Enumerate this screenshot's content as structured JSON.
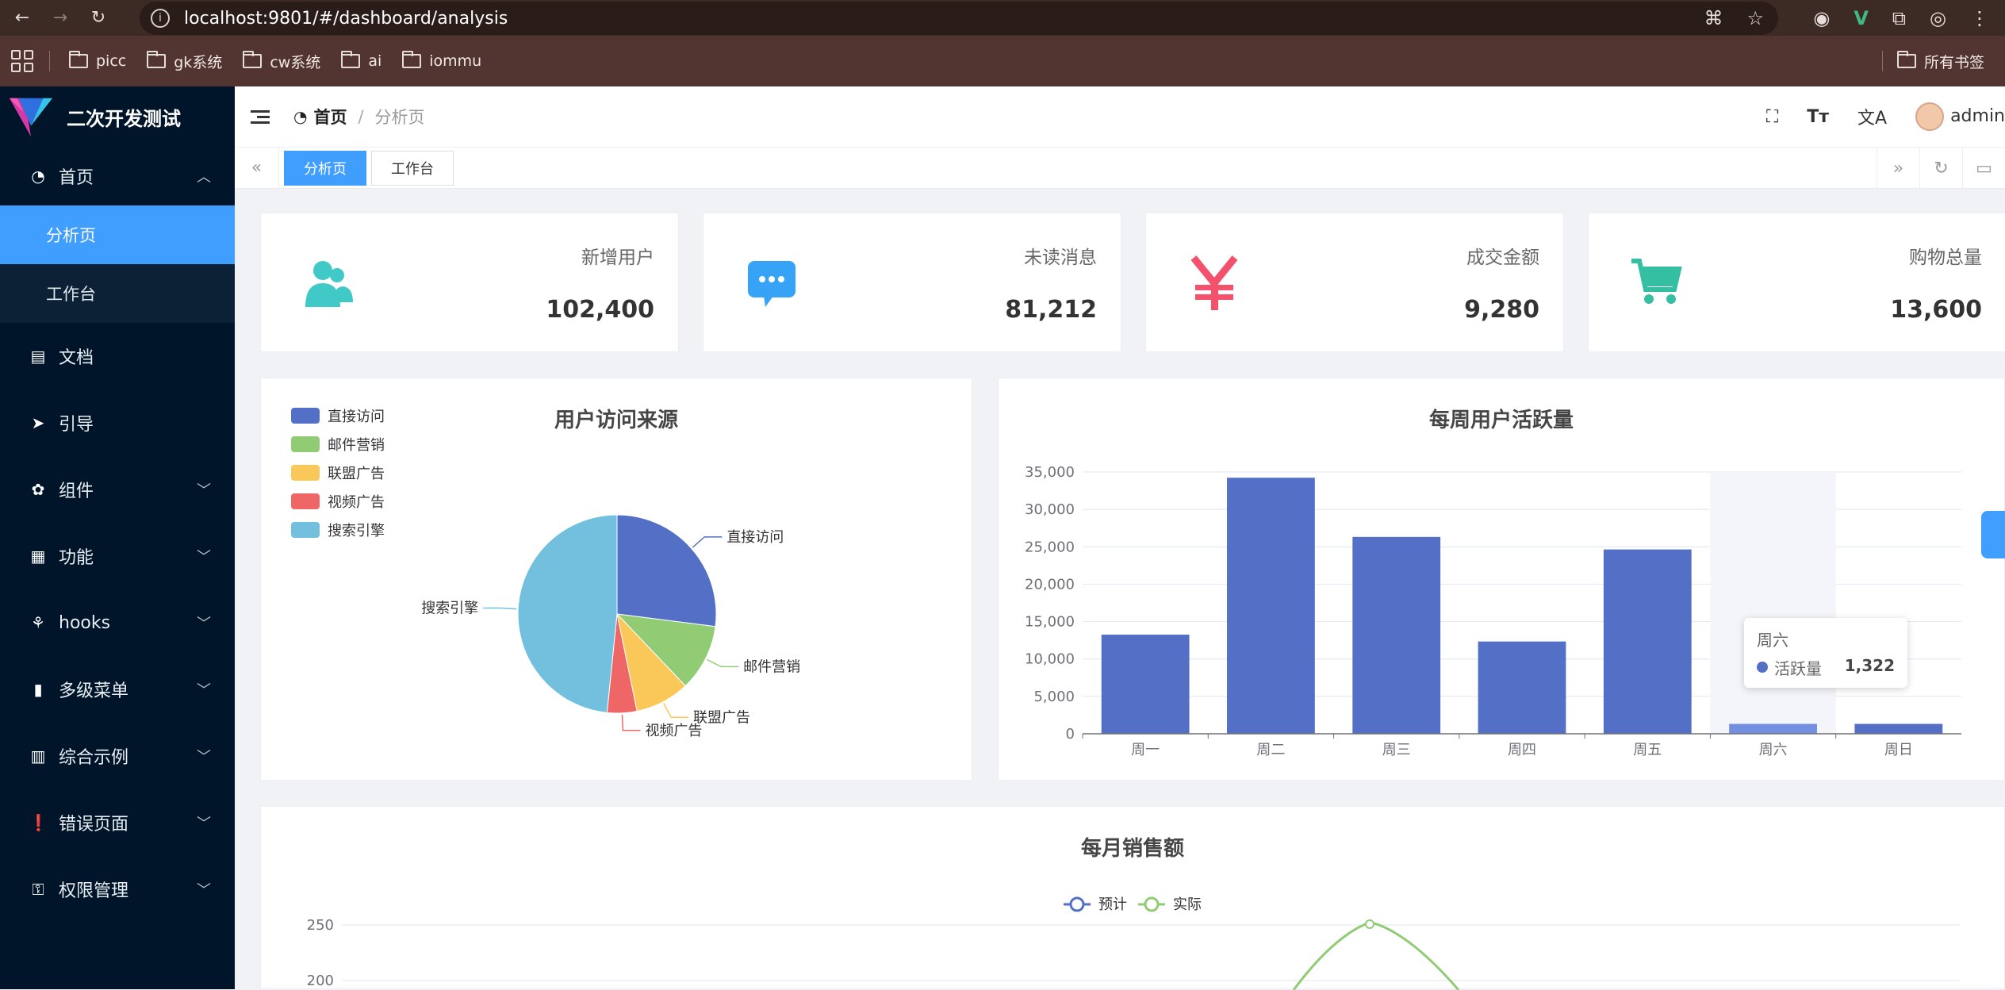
{
  "browser": {
    "url": "localhost:9801/#/dashboard/analysis",
    "bookmarks": [
      "picc",
      "gk系统",
      "cw系统",
      "ai",
      "iommu"
    ],
    "bookmarks_right": "所有书签"
  },
  "sidebar": {
    "logo_text": "二次开发测试",
    "items": [
      {
        "label": "首页",
        "icon": "dashboard-icon"
      },
      {
        "label": "文档",
        "icon": "document-icon"
      },
      {
        "label": "引导",
        "icon": "send-icon"
      },
      {
        "label": "组件",
        "icon": "component-icon"
      },
      {
        "label": "功能",
        "icon": "grid-icon"
      },
      {
        "label": "hooks",
        "icon": "hooks-icon"
      },
      {
        "label": "多级菜单",
        "icon": "bar-chart-icon"
      },
      {
        "label": "综合示例",
        "icon": "library-icon"
      },
      {
        "label": "错误页面",
        "icon": "warning-icon"
      },
      {
        "label": "权限管理",
        "icon": "permission-icon"
      }
    ],
    "sub_items": [
      "分析页",
      "工作台"
    ]
  },
  "header": {
    "breadcrumb_home": "首页",
    "breadcrumb_current": "分析页",
    "user": "admin"
  },
  "tabs": [
    "分析页",
    "工作台"
  ],
  "stats": [
    {
      "label": "新增用户",
      "value": "102,400",
      "icon": "users-icon",
      "color": "#40c9c6"
    },
    {
      "label": "未读消息",
      "value": "81,212",
      "icon": "message-icon",
      "color": "#36a3f7"
    },
    {
      "label": "成交金额",
      "value": "9,280",
      "icon": "yen-icon",
      "color": "#f4516c"
    },
    {
      "label": "购物总量",
      "value": "13,600",
      "icon": "cart-icon",
      "color": "#34bfa3"
    }
  ],
  "chart_data": [
    {
      "type": "pie",
      "title": "用户访问来源",
      "categories": [
        "直接访问",
        "邮件营销",
        "联盟广告",
        "视频广告",
        "搜索引擎"
      ],
      "values": [
        335,
        135,
        110,
        60,
        600
      ],
      "colors": [
        "#5470c6",
        "#91cc75",
        "#fac858",
        "#ee6666",
        "#73c0de"
      ],
      "legend": "top-left"
    },
    {
      "type": "bar",
      "title": "每周用户活跃量",
      "categories": [
        "周一",
        "周二",
        "周三",
        "周四",
        "周五",
        "周六",
        "周日"
      ],
      "values": [
        13253,
        34235,
        26321,
        12340,
        24643,
        1322,
        1324
      ],
      "ylim": [
        0,
        35000
      ],
      "yticks": [
        "0",
        "5,000",
        "10,000",
        "15,000",
        "20,000",
        "25,000",
        "30,000",
        "35,000"
      ],
      "color": "#5470c6",
      "tooltip": {
        "title": "周六",
        "series": "活跃量",
        "value": "1,322"
      }
    },
    {
      "type": "line",
      "title": "每月销售额",
      "legend": [
        "预计",
        "实际"
      ],
      "colors": [
        "#5470c6",
        "#91cc75"
      ],
      "yticks_visible": [
        "250",
        "200"
      ],
      "series": [
        {
          "name": "预计",
          "values": []
        },
        {
          "name": "实际",
          "values": [
            null,
            null,
            null,
            null,
            null,
            null,
            250
          ]
        }
      ]
    }
  ]
}
